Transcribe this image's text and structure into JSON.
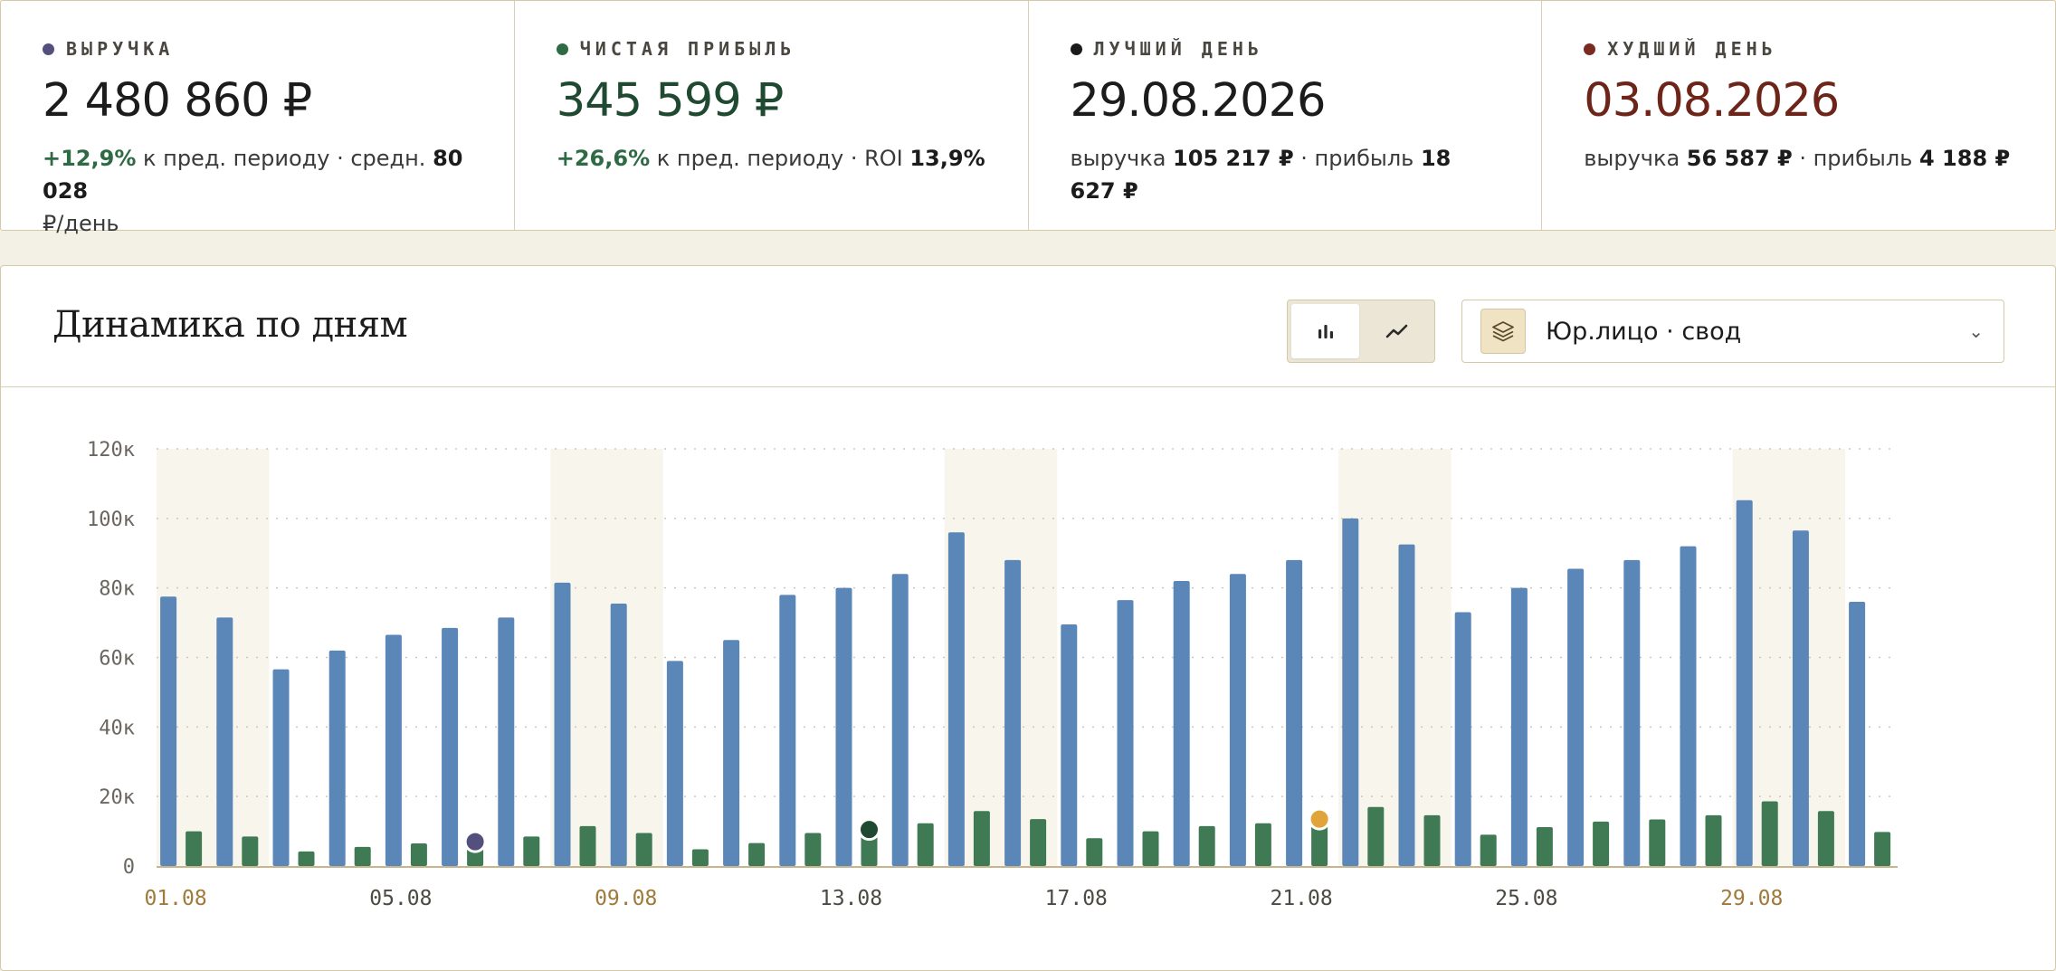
{
  "kpis": [
    {
      "label": "ВЫРУЧКА",
      "value": "2 480 860 ₽",
      "dot_color": "#54507e",
      "value_color": "#1c1c1c",
      "sub_delta": "+12,9%",
      "sub_text1": " к пред. периоду · средн. ",
      "sub_bold": "80 028",
      "sub_text2": "₽/день"
    },
    {
      "label": "ЧИСТАЯ ПРИБЫЛЬ",
      "value": "345 599 ₽",
      "dot_color": "#2e6b45",
      "value_color": "#1f4a31",
      "sub_delta": "+26,6%",
      "sub_text1": " к пред. периоду · ROI ",
      "sub_bold": "13,9%",
      "sub_text2": ""
    },
    {
      "label": "ЛУЧШИЙ ДЕНЬ",
      "value": "29.08.2026",
      "dot_color": "#1a1a1a",
      "value_color": "#1c1c1c",
      "sub_pre": "выручка ",
      "sub_b1": "105 217 ₽",
      "sub_mid": " · прибыль ",
      "sub_b2": "18 627 ₽"
    },
    {
      "label": "ХУДШИЙ ДЕНЬ",
      "value": "03.08.2026",
      "dot_color": "#7a2a20",
      "value_color": "#6e2519",
      "sub_pre": "выручка ",
      "sub_b1": "56 587 ₽",
      "sub_mid": " · прибыль ",
      "sub_b2": "4 188 ₽"
    }
  ],
  "panel": {
    "title": "Динамика по дням",
    "view_toggle": {
      "options": [
        "bar-chart-icon",
        "line-chart-icon"
      ],
      "active": "bar-chart-icon"
    },
    "entity_select": {
      "value": "Юр.лицо · свод",
      "icon": "layers-icon",
      "chevron": "chevron-down-icon"
    }
  },
  "chart_data": {
    "type": "bar",
    "x": [
      "01.08",
      "02.08",
      "03.08",
      "04.08",
      "05.08",
      "06.08",
      "07.08",
      "08.08",
      "09.08",
      "10.08",
      "11.08",
      "12.08",
      "13.08",
      "14.08",
      "15.08",
      "16.08",
      "17.08",
      "18.08",
      "19.08",
      "20.08",
      "21.08",
      "22.08",
      "23.08",
      "24.08",
      "25.08",
      "26.08",
      "27.08",
      "28.08",
      "29.08",
      "30.08",
      "31.08"
    ],
    "x_tick_labels": [
      "01.08",
      "05.08",
      "09.08",
      "13.08",
      "17.08",
      "21.08",
      "25.08",
      "29.08"
    ],
    "highlighted_tick_labels": [
      "01.08",
      "09.08",
      "29.08"
    ],
    "weekend_groups": [
      [
        "01.08",
        "02.08"
      ],
      [
        "08.08",
        "09.08"
      ],
      [
        "15.08",
        "16.08"
      ],
      [
        "22.08",
        "23.08"
      ],
      [
        "29.08",
        "30.08"
      ]
    ],
    "series": [
      {
        "color": "#5b86b8",
        "values": [
          77500,
          71500,
          56587,
          62000,
          66500,
          68500,
          71500,
          81500,
          75500,
          59000,
          65000,
          78000,
          80000,
          84000,
          96000,
          88000,
          69500,
          76500,
          82000,
          84000,
          88000,
          100000,
          92500,
          73000,
          80000,
          85500,
          88000,
          92000,
          105217,
          96500,
          76000
        ]
      },
      {
        "color": "#3f7a55",
        "values": [
          10000,
          8500,
          4188,
          5500,
          6500,
          7500,
          8500,
          11500,
          9500,
          4800,
          6600,
          9500,
          11000,
          12300,
          15800,
          13500,
          8000,
          10000,
          11500,
          12300,
          11800,
          17000,
          14600,
          9000,
          11200,
          12800,
          13400,
          14600,
          18627,
          15800,
          9800
        ]
      }
    ],
    "markers": [
      {
        "x": "06.08",
        "y": 7000,
        "color": "#54507e"
      },
      {
        "x": "13.08",
        "y": 10500,
        "color": "#1f4a31"
      },
      {
        "x": "21.08",
        "y": 13500,
        "color": "#e0a43a"
      }
    ],
    "y_ticks": [
      "0",
      "20к",
      "40к",
      "60к",
      "80к",
      "100к",
      "120к"
    ],
    "ylim": [
      0,
      120000
    ],
    "grid": true
  }
}
